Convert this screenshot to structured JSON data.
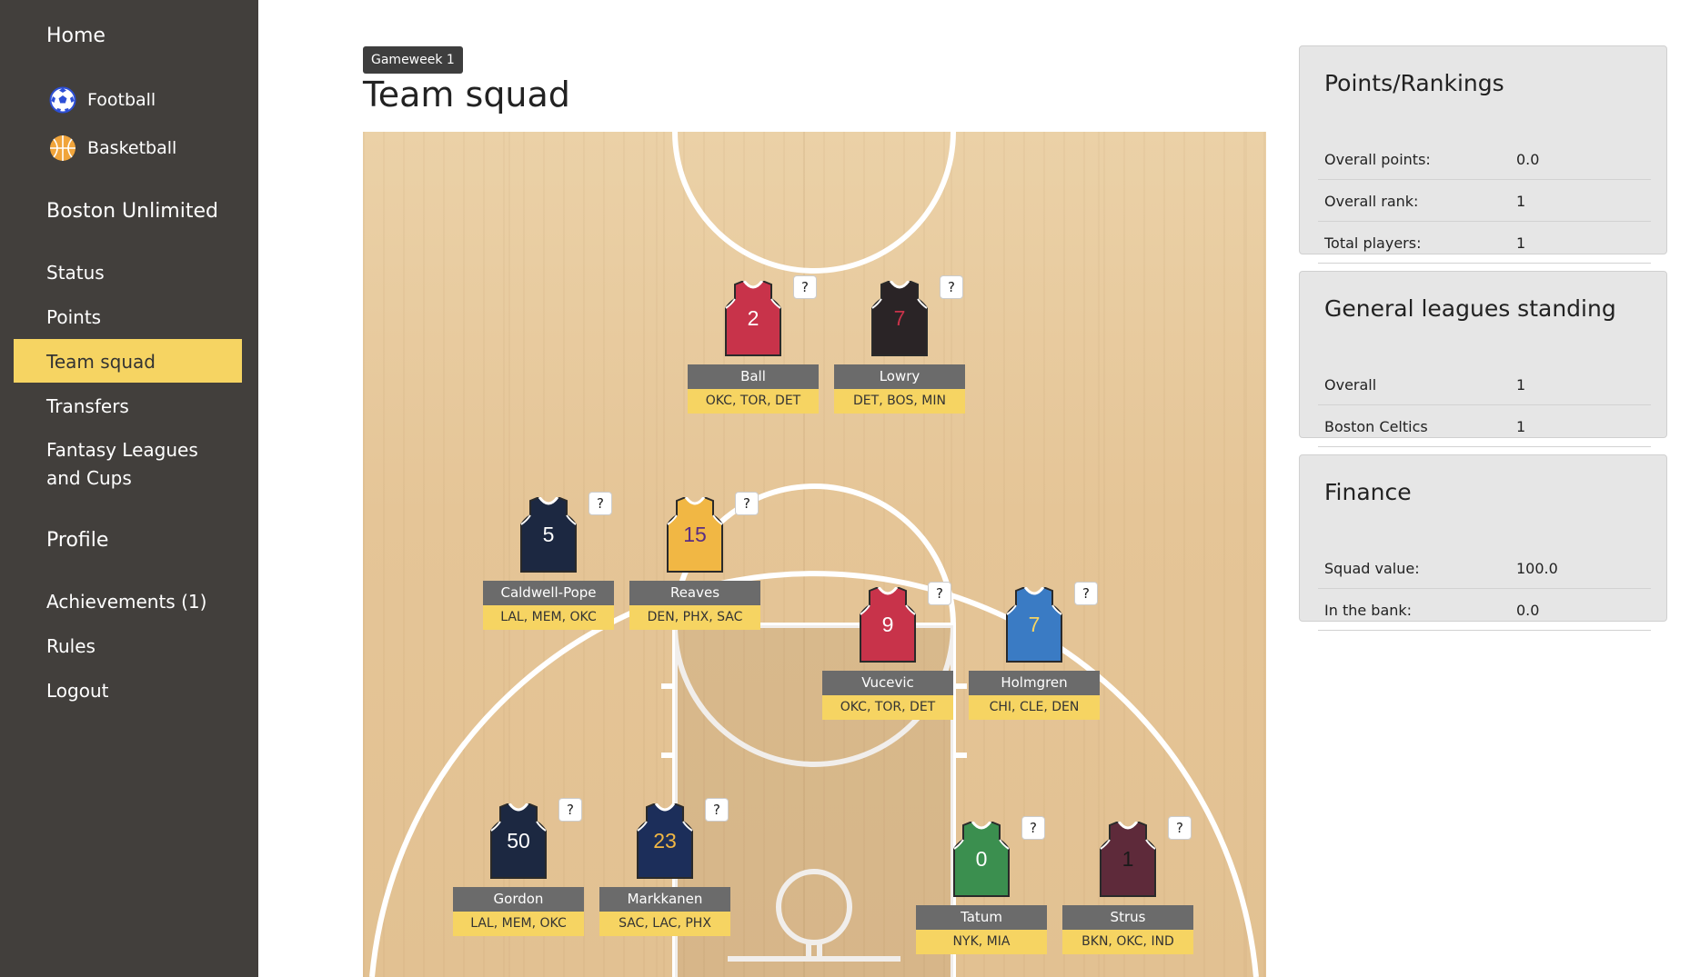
{
  "sidebar": {
    "home": "Home",
    "sports": [
      {
        "label": "Football",
        "icon": "football-icon"
      },
      {
        "label": "Basketball",
        "icon": "basketball-icon"
      }
    ],
    "league_name": "Boston Unlimited",
    "nav": [
      "Status",
      "Points",
      "Team squad",
      "Transfers",
      "Fantasy Leagues and Cups"
    ],
    "active": "Team squad",
    "profile": "Profile",
    "profile_nav": [
      "Achievements (1)",
      "Rules",
      "Logout"
    ]
  },
  "main": {
    "badge": "Gameweek 1",
    "title": "Team squad"
  },
  "players": [
    {
      "name": "Ball",
      "number": "2",
      "fixtures": "OKC, TOR, DET",
      "jersey_color": "#c8334a",
      "number_color": "#ffffff",
      "info": "?"
    },
    {
      "name": "Lowry",
      "number": "7",
      "fixtures": "DET, BOS, MIN",
      "jersey_color": "#2a2426",
      "number_color": "#c8334a",
      "info": "?"
    },
    {
      "name": "Caldwell-Pope",
      "number": "5",
      "fixtures": "LAL, MEM, OKC",
      "jersey_color": "#1c2841",
      "number_color": "#ffffff",
      "info": "?"
    },
    {
      "name": "Reaves",
      "number": "15",
      "fixtures": "DEN, PHX, SAC",
      "jersey_color": "#f1b744",
      "number_color": "#5a2d82",
      "info": "?"
    },
    {
      "name": "Vucevic",
      "number": "9",
      "fixtures": "OKC, TOR, DET",
      "jersey_color": "#c8334a",
      "number_color": "#ffffff",
      "info": "?"
    },
    {
      "name": "Holmgren",
      "number": "7",
      "fixtures": "CHI, CLE, DEN",
      "jersey_color": "#3a7bc4",
      "number_color": "#f6d462",
      "info": "?"
    },
    {
      "name": "Gordon",
      "number": "50",
      "fixtures": "LAL, MEM, OKC",
      "jersey_color": "#1c2841",
      "number_color": "#ffffff",
      "info": "?"
    },
    {
      "name": "Markkanen",
      "number": "23",
      "fixtures": "SAC, LAC, PHX",
      "jersey_color": "#1c2e5a",
      "number_color": "#f1b744",
      "info": "?"
    },
    {
      "name": "Tatum",
      "number": "0",
      "fixtures": "NYK, MIA",
      "jersey_color": "#3b8f4f",
      "number_color": "#ffffff",
      "info": "?"
    },
    {
      "name": "Strus",
      "number": "1",
      "fixtures": "BKN, OKC, IND",
      "jersey_color": "#5e2a3a",
      "number_color": "#1a1a1a",
      "info": "?"
    }
  ],
  "panels": {
    "points": {
      "title": "Points/Rankings",
      "rows": [
        {
          "label": "Overall points:",
          "value": "0.0"
        },
        {
          "label": "Overall rank:",
          "value": "1"
        },
        {
          "label": "Total players:",
          "value": "1"
        }
      ]
    },
    "leagues": {
      "title": "General leagues standing",
      "rows": [
        {
          "label": "Overall",
          "value": "1"
        },
        {
          "label": "Boston Celtics",
          "value": "1"
        }
      ]
    },
    "finance": {
      "title": "Finance",
      "rows": [
        {
          "label": "Squad value:",
          "value": "100.0"
        },
        {
          "label": "In the bank:",
          "value": "0.0"
        }
      ]
    }
  },
  "colors": {
    "sidebar_bg": "#423f3c",
    "active_bg": "#f6d462",
    "fixture_bg": "#f6d462",
    "name_bg": "#6b6b6b"
  }
}
